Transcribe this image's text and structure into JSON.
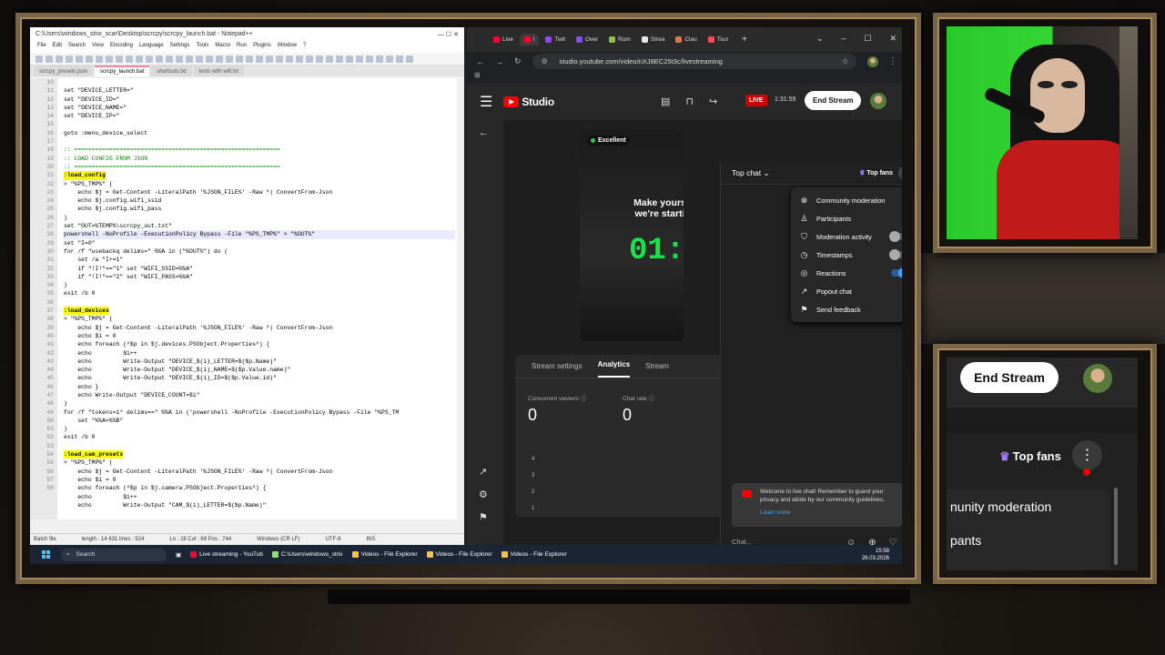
{
  "notepad": {
    "title": "C:\\Users\\windows_strix_scar\\Desktop\\scrcpy\\scrcpy_launch.bat - Notepad++",
    "menu": [
      "File",
      "Edit",
      "Search",
      "View",
      "Encoding",
      "Language",
      "Settings",
      "Tools",
      "Macro",
      "Run",
      "Plugins",
      "Window",
      "?"
    ],
    "tabs": [
      "scrcpy_presets.json",
      "scrcpy_launch.bat",
      "shortcuts.txt",
      "tests with wifi.txt"
    ],
    "active_tab": 1,
    "line_numbers": [
      "10",
      "11",
      "12",
      "13",
      "14",
      "15",
      "16",
      "17",
      "18",
      "19",
      "20",
      "21",
      "22",
      "23",
      "24",
      "25",
      "26",
      "27",
      "28",
      "29",
      "30",
      "31",
      "32",
      "33",
      "34",
      "35",
      "36",
      "37",
      "38",
      "39",
      "40",
      "41",
      "42",
      "43",
      "44",
      "45",
      "46",
      "47",
      "48",
      "49",
      "50",
      "51",
      "52",
      "53",
      "54",
      "55",
      "56",
      "57",
      "58"
    ],
    "code": [
      "",
      "set \"DEVICE_LETTER=\"",
      "set \"DEVICE_ID=\"",
      "set \"DEVICE_NAME=\"",
      "set \"DEVICE_IP=\"",
      "",
      "goto :menu_device_select",
      "",
      ":: ===========================================================",
      ":: LOAD CONFIG FROM JSON",
      ":: ===========================================================",
      ":load_config",
      "> \"%PS_TMP%\" (",
      "    echo $j = Get-Content -LiteralPath '%JSON_FILE%' -Raw ^| ConvertFrom-Json",
      "    echo $j.config.wifi_ssid",
      "    echo $j.config.wifi_pass",
      ")",
      "set \"OUT=%TEMP%\\scrcpy_out.txt\"",
      "powershell -NoProfile -ExecutionPolicy Bypass -File \"%PS_TMP%\" > \"%OUT%\"",
      "set \"I=0\"",
      "for /f \"usebackq delims=\" %%A in (\"%OUT%\") do (",
      "    set /a \"I+=1\"",
      "    if \"!I!\"==\"1\" set \"WIFI_SSID=%%A\"",
      "    if \"!I!\"==\"2\" set \"WIFI_PASS=%%A\"",
      ")",
      "exit /b 0",
      "",
      ":load_devices",
      "> \"%PS_TMP%\" (",
      "    echo $j = Get-Content -LiteralPath '%JSON_FILE%' -Raw ^| ConvertFrom-Json",
      "    echo $i = 0",
      "    echo foreach (^$p in $j.devices.PSObject.Properties^) {",
      "    echo         $i++",
      "    echo         Write-Output \"DEVICE_$(i)_LETTER=$($p.Name)\"",
      "    echo         Write-Output \"DEVICE_$(i)_NAME=$($p.Value.name)\"",
      "    echo         Write-Output \"DEVICE_$(i)_ID=$($p.Value.id)\"",
      "    echo }",
      "    echo Write-Output \"DEVICE_COUNT=$i\"",
      ")",
      "for /f \"tokens=1* delims==\" %%A in ('powershell -NoProfile -ExecutionPolicy Bypass -File \"%PS_TM",
      "    set \"%%A=%%B\"",
      ")",
      "exit /b 0",
      "",
      ":load_cam_presets",
      "> \"%PS_TMP%\" (",
      "    echo $j = Get-Content -LiteralPath '%JSON_FILE%' -Raw ^| ConvertFrom-Json",
      "    echo $i = 0",
      "    echo foreach (^$p in $j.camera.PSObject.Properties^) {",
      "    echo         $i++",
      "    echo         Write-Output \"CAM_$(i)_LETTER=$($p.Name)\""
    ],
    "status": {
      "type": "Batch file",
      "length": "length : 14 631   lines : 524",
      "pos": "Ln : 28    Col : 69    Pos : 744",
      "eol": "Windows (CR LF)",
      "enc": "UTF-8",
      "mode": "INS"
    }
  },
  "browser": {
    "tabs": [
      {
        "label": "Live",
        "color": "#ff0033"
      },
      {
        "label": "l",
        "color": "#ff0033"
      },
      {
        "label": "Twit",
        "color": "#9146ff"
      },
      {
        "label": "Over",
        "color": "#9146ff"
      },
      {
        "label": "Rum",
        "color": "#85c742"
      },
      {
        "label": "Strea",
        "color": "#e8e8e8"
      },
      {
        "label": "Clau",
        "color": "#d97757"
      },
      {
        "label": "Tiun",
        "color": "#ff4f4f"
      }
    ],
    "url": "studio.youtube.com/video/nXJ8EC25t3c/livestreaming"
  },
  "studio": {
    "logo_text": "Studio",
    "live_badge": "LIVE",
    "live_time": "1:31:59",
    "end_stream": "End Stream",
    "preview": {
      "quality": "Excellent",
      "text": "Make yours we're starti",
      "timer": "01:"
    },
    "stats_tabs": [
      "Stream settings",
      "Analytics",
      "Stream"
    ],
    "active_stats_tab": 1,
    "metrics": [
      {
        "label": "Concurrent viewers",
        "value": "0"
      },
      {
        "label": "Chat rate",
        "value": "0"
      }
    ],
    "y_ticks": [
      "4",
      "3",
      "2",
      "1"
    ],
    "chat": {
      "title": "Top chat",
      "top_fans": "Top fans",
      "menu": [
        {
          "label": "Community moderation",
          "icon": "shield-x-icon",
          "toggle": null
        },
        {
          "label": "Participants",
          "icon": "person-icon",
          "toggle": null
        },
        {
          "label": "Moderation activity",
          "icon": "shield-icon",
          "toggle": "off"
        },
        {
          "label": "Timestamps",
          "icon": "clock-icon",
          "toggle": "off"
        },
        {
          "label": "Reactions",
          "icon": "reaction-icon",
          "toggle": "on"
        },
        {
          "label": "Popout chat",
          "icon": "popout-icon",
          "toggle": null
        },
        {
          "label": "Send feedback",
          "icon": "feedback-icon",
          "toggle": null
        }
      ],
      "welcome": "Welcome to live chat! Remember to guard your privacy and abide by our community guidelines.",
      "learn_more": "Learn more",
      "input_placeholder": "Chat..."
    }
  },
  "taskbar": {
    "search": "Search",
    "apps": [
      {
        "label": "Live streaming - YouTub",
        "color": "#ff0033"
      },
      {
        "label": "C:\\Users\\windows_strix",
        "color": "#90e070"
      },
      {
        "label": "Videos - File Explorer",
        "color": "#f4c542"
      },
      {
        "label": "Videos - File Explorer",
        "color": "#f4c542"
      },
      {
        "label": "Videos - File Explorer",
        "color": "#f4c542"
      }
    ],
    "time": "15:58",
    "date": "26.03.2026"
  },
  "zoom": {
    "end_stream": "End Stream",
    "top_fans": "Top fans",
    "menu": [
      "nunity moderation",
      "pants"
    ]
  }
}
